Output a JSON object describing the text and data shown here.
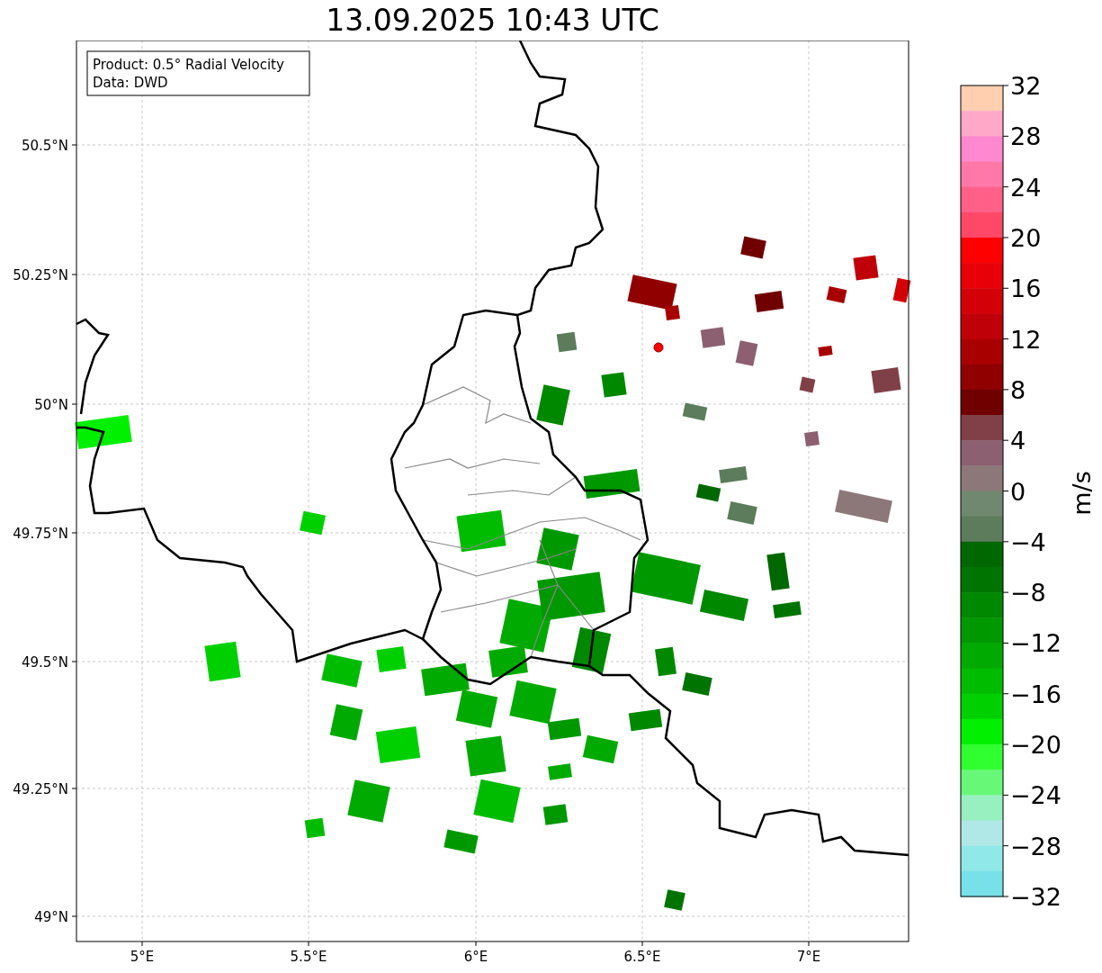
{
  "title": "13.09.2025 10:43 UTC",
  "map": {
    "info_box": [
      "Product: 0.5° Radial Velocity",
      "Data: DWD"
    ],
    "yticks": [
      "50.5°N",
      "50.25°N",
      "50°N",
      "49.75°N",
      "49.5°N",
      "49.25°N",
      "49°N"
    ],
    "xticks": [
      "5°E",
      "5.5°E",
      "6°E",
      "6.5°E",
      "7°E"
    ]
  },
  "colorbar": {
    "label": "m/s",
    "ticks": [
      "32",
      "28",
      "24",
      "20",
      "16",
      "12",
      "8",
      "4",
      "0",
      "−4",
      "−8",
      "−12",
      "−16",
      "−20",
      "−24",
      "−28",
      "−32"
    ]
  }
}
